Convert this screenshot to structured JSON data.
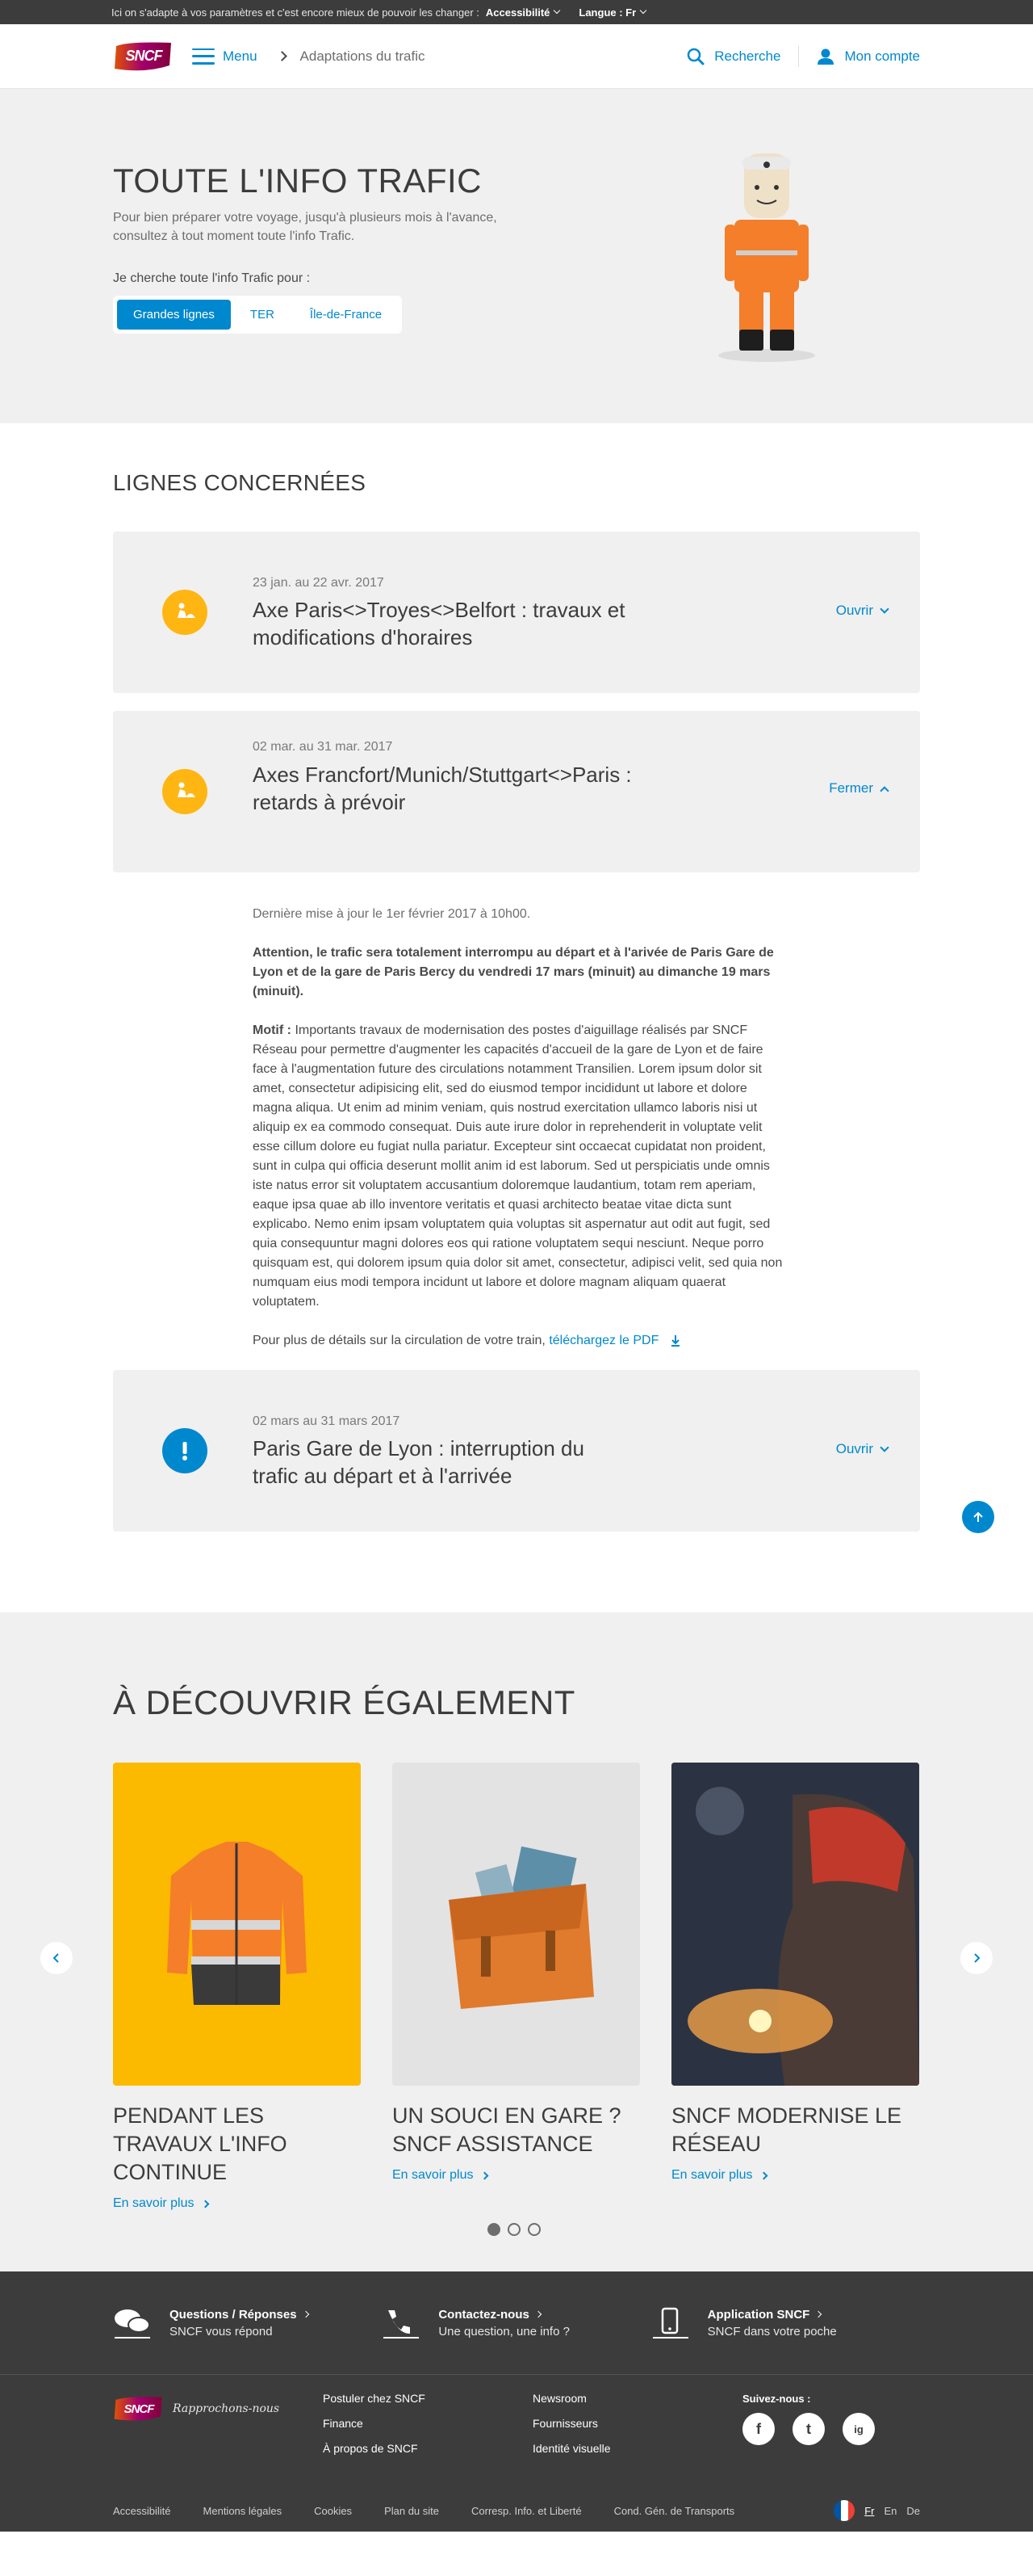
{
  "topbar": {
    "text": "Ici on s'adapte à vos paramètres et c'est encore mieux de pouvoir les changer :",
    "accessibility": "Accessibilité",
    "language": "Langue : Fr"
  },
  "header": {
    "logo": "SNCF",
    "menu": "Menu",
    "breadcrumb": "Adaptations du trafic",
    "search": "Recherche",
    "account": "Mon compte"
  },
  "hero": {
    "title": "TOUTE L'INFO TRAFIC",
    "intro": "Pour bien préparer votre voyage, jusqu'à plusieurs mois à l'avance, consultez à tout moment toute l'info Trafic.",
    "lookfor": "Je cherche toute l'info Trafic pour :",
    "tabs": [
      "Grandes lignes",
      "TER",
      "Île-de-France"
    ]
  },
  "lines": {
    "title": "LIGNES CONCERNÉES",
    "cards": [
      {
        "date": "23 jan. au 22 avr. 2017",
        "title": "Axe Paris<>Troyes<>Belfort : travaux et modifications d'horaires",
        "toggle": "Ouvrir",
        "icon": "works-icon"
      },
      {
        "date": "02 mar. au 31 mar. 2017",
        "title": "Axes Francfort/Munich/Stuttgart<>Paris : retards à prévoir",
        "toggle": "Fermer",
        "icon": "works-icon"
      },
      {
        "date": "02 mars au 31 mars 2017",
        "title": "Paris Gare de Lyon : interruption du trafic au départ et à l'arrivée",
        "toggle": "Ouvrir",
        "icon": "alert-icon"
      }
    ],
    "details": {
      "update": "Dernière mise à jour le 1er février 2017 à 10h00.",
      "strong": "Attention, le trafic sera totalement interrompu au départ et à l'arivée de Paris Gare de Lyon et de la gare de Paris Bercy du vendredi 17 mars (minuit) au dimanche 19 mars (minuit).",
      "motif_label": "Motif :",
      "motif": "Importants travaux de modernisation des postes d'aiguillage réalisés par SNCF Réseau pour permettre d'augmenter les capacités d'accueil de la gare de Lyon et de faire face à l'augmentation future des circulations notamment Transilien. Lorem ipsum dolor sit amet, consectetur adipisicing elit, sed do eiusmod tempor incididunt ut labore et dolore magna aliqua. Ut enim ad minim veniam, quis nostrud exercitation ullamco laboris nisi ut aliquip ex ea commodo consequat. Duis aute irure dolor in reprehenderit in voluptate velit esse cillum dolore eu fugiat nulla pariatur. Excepteur sint occaecat cupidatat non proident, sunt in culpa qui officia deserunt mollit anim id est laborum. Sed ut perspiciatis unde omnis iste natus error sit voluptatem accusantium doloremque laudantium, totam rem aperiam, eaque ipsa quae ab illo inventore veritatis et quasi architecto beatae vitae dicta sunt explicabo. Nemo enim ipsam voluptatem quia voluptas sit aspernatur aut odit aut fugit, sed quia consequuntur magni dolores eos qui ratione voluptatem sequi nesciunt. Neque porro quisquam est, qui dolorem ipsum quia dolor sit amet, consectetur, adipisci velit, sed quia non numquam eius modi tempora incidunt ut labore et dolore magnam aliquam quaerat voluptatem.",
      "more": "Pour plus de détails sur la circulation de votre train,",
      "pdf": "téléchargez le PDF"
    }
  },
  "discover": {
    "title": "À DÉCOUVRIR ÉGALEMENT",
    "cards": [
      {
        "title": "PENDANT LES TRAVAUX L'INFO CONTINUE",
        "link": "En savoir plus"
      },
      {
        "title": "UN SOUCI EN GARE ? SNCF ASSISTANCE",
        "link": "En savoir plus"
      },
      {
        "title": "SNCF MODERNISE LE RÉSEAU",
        "link": "En savoir plus"
      }
    ]
  },
  "footer": {
    "top": [
      {
        "t1": "Questions / Réponses",
        "t2": "SNCF vous répond"
      },
      {
        "t1": "Contactez-nous",
        "t2": "Une question, une info ?"
      },
      {
        "t1": "Application SNCF",
        "t2": "SNCF dans votre poche"
      }
    ],
    "tagline": "Rapprochons-nous",
    "links_a": [
      "Postuler chez SNCF",
      "Finance",
      "À propos de SNCF"
    ],
    "links_b": [
      "Newsroom",
      "Fournisseurs",
      "Identité visuelle"
    ],
    "follow": "Suivez-nous :",
    "social": [
      "f",
      "t",
      "ig"
    ],
    "bottom": [
      "Accessibilité",
      "Mentions légales",
      "Cookies",
      "Plan du site",
      "Corresp. Info. et Liberté",
      "Cond. Gén. de Transports"
    ],
    "langs": [
      "Fr",
      "En",
      "De"
    ]
  },
  "colors": {
    "accent": "#0088ce",
    "warning": "#ffb612",
    "dark": "#3c3c3c",
    "light": "#f0f0f0"
  }
}
